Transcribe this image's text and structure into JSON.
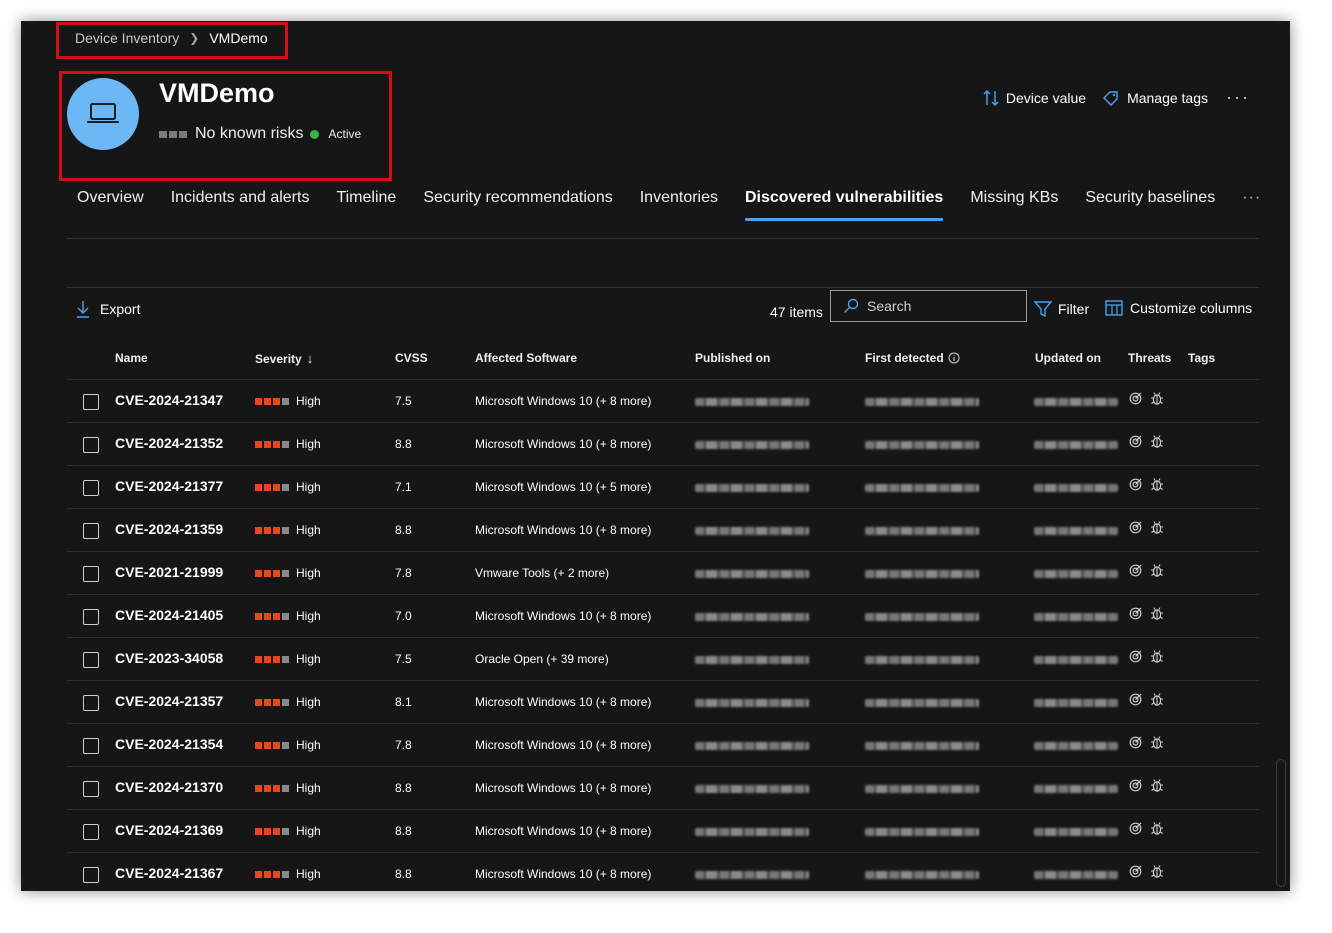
{
  "breadcrumb": {
    "parent": "Device Inventory",
    "current": "VMDemo"
  },
  "device": {
    "name": "VMDemo",
    "risk": "No known risks",
    "status": "Active",
    "status_color": "#3bb44a",
    "avatar_color": "#6cb8f6"
  },
  "actions": {
    "device_value": "Device value",
    "manage_tags": "Manage tags",
    "more": "···"
  },
  "tabs": [
    {
      "label": "Overview",
      "active": false
    },
    {
      "label": "Incidents and alerts",
      "active": false
    },
    {
      "label": "Timeline",
      "active": false
    },
    {
      "label": "Security recommendations",
      "active": false
    },
    {
      "label": "Inventories",
      "active": false
    },
    {
      "label": "Discovered vulnerabilities",
      "active": true
    },
    {
      "label": "Missing KBs",
      "active": false
    },
    {
      "label": "Security baselines",
      "active": false
    }
  ],
  "tabs_more": "···",
  "toolbar": {
    "export": "Export",
    "items_count": "47 items",
    "search_placeholder": "Search",
    "filter": "Filter",
    "customize_columns": "Customize columns"
  },
  "table": {
    "columns": {
      "name": "Name",
      "severity": "Severity",
      "cvss": "CVSS",
      "affected_software": "Affected Software",
      "published_on": "Published on",
      "first_detected": "First detected",
      "updated_on": "Updated on",
      "threats": "Threats",
      "tags": "Tags"
    },
    "rows": [
      {
        "name": "CVE-2024-21347",
        "severity": "High",
        "cvss": "7.5",
        "software": "Microsoft Windows 10 (+ 8 more)"
      },
      {
        "name": "CVE-2024-21352",
        "severity": "High",
        "cvss": "8.8",
        "software": "Microsoft Windows 10 (+ 8 more)"
      },
      {
        "name": "CVE-2024-21377",
        "severity": "High",
        "cvss": "7.1",
        "software": "Microsoft Windows 10 (+ 5 more)"
      },
      {
        "name": "CVE-2024-21359",
        "severity": "High",
        "cvss": "8.8",
        "software": "Microsoft Windows 10 (+ 8 more)"
      },
      {
        "name": "CVE-2021-21999",
        "severity": "High",
        "cvss": "7.8",
        "software": "Vmware Tools (+ 2 more)"
      },
      {
        "name": "CVE-2024-21405",
        "severity": "High",
        "cvss": "7.0",
        "software": "Microsoft Windows 10 (+ 8 more)"
      },
      {
        "name": "CVE-2023-34058",
        "severity": "High",
        "cvss": "7.5",
        "software": "Oracle Open (+ 39 more)"
      },
      {
        "name": "CVE-2024-21357",
        "severity": "High",
        "cvss": "8.1",
        "software": "Microsoft Windows 10 (+ 8 more)"
      },
      {
        "name": "CVE-2024-21354",
        "severity": "High",
        "cvss": "7.8",
        "software": "Microsoft Windows 10 (+ 8 more)"
      },
      {
        "name": "CVE-2024-21370",
        "severity": "High",
        "cvss": "8.8",
        "software": "Microsoft Windows 10 (+ 8 more)"
      },
      {
        "name": "CVE-2024-21369",
        "severity": "High",
        "cvss": "8.8",
        "software": "Microsoft Windows 10 (+ 8 more)"
      },
      {
        "name": "CVE-2024-21367",
        "severity": "High",
        "cvss": "8.8",
        "software": "Microsoft Windows 10 (+ 8 more)"
      }
    ]
  },
  "colors": {
    "accent": "#4aa3f0",
    "severity_high": "#e8471c",
    "highlight_box": "#d20f17",
    "background": "#161616"
  }
}
